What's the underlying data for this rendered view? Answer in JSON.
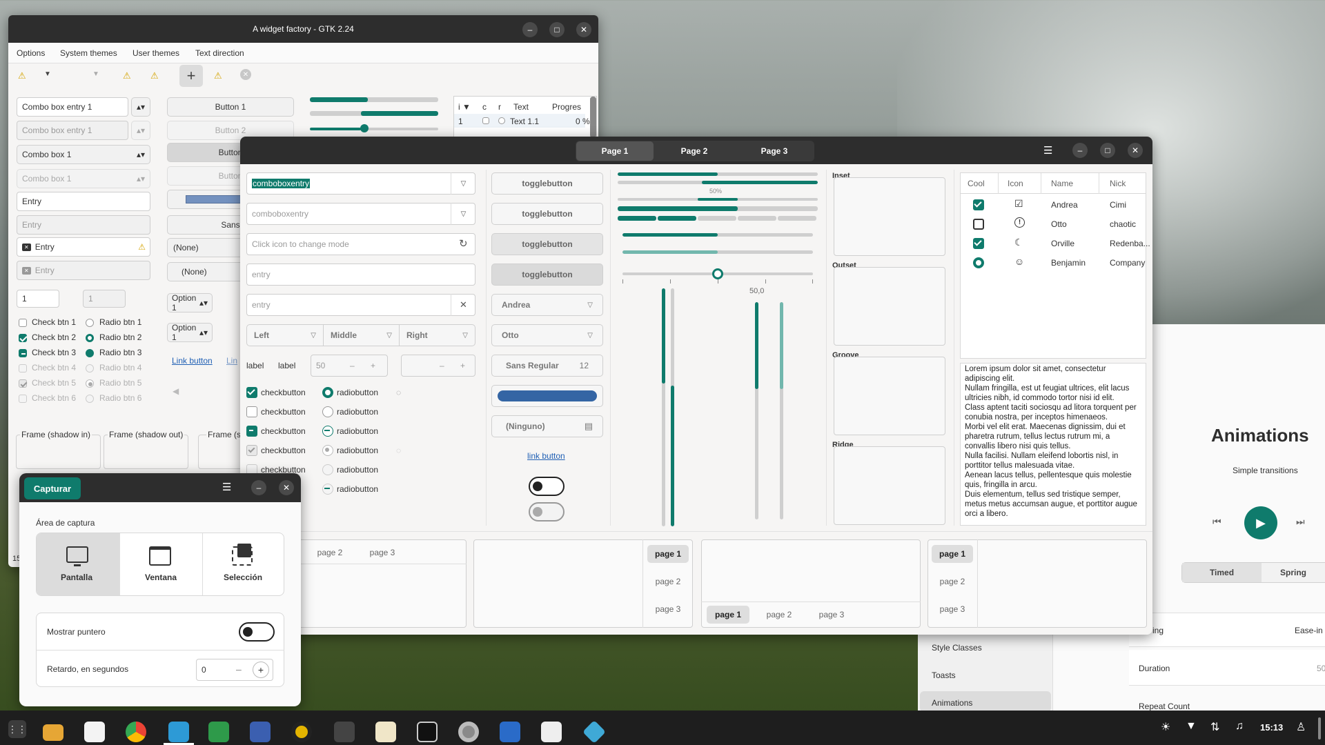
{
  "colors": {
    "accent": "#0f7b6c",
    "blue": "#3465a4",
    "dark": "#2d2d2d"
  },
  "gtk2": {
    "title": "A widget factory - GTK 2.24",
    "menu": [
      "Options",
      "System themes",
      "User themes",
      "Text direction"
    ],
    "combo_entry_1": "Combo box entry 1",
    "combo_entry_1_dis": "Combo box entry 1",
    "combo_box_1": "Combo box 1",
    "combo_box_1_dis": "Combo box 1",
    "entry": "Entry",
    "entry_dis": "Entry",
    "entry_icon": "Entry",
    "entry_icon_dis": "Entry",
    "spin1": "1",
    "spin2": "1",
    "checks": [
      "Check btn 1",
      "Check btn 2",
      "Check btn 3",
      "Check btn 4",
      "Check btn 5",
      "Check btn 6"
    ],
    "radios": [
      "Radio btn 1",
      "Radio btn 2",
      "Radio btn 3",
      "Radio btn 4",
      "Radio btn 5",
      "Radio btn 6"
    ],
    "buttons": [
      "Button 1",
      "Button 2",
      "Button",
      "Button"
    ],
    "font_btn": "Sans",
    "none1": "(None)",
    "none2": "(None)",
    "option1": "Option 1",
    "option2": "Option 1",
    "link1": "Link button",
    "link2": "Lin",
    "frames": [
      "Frame (shadow in)",
      "Frame (shadow out)",
      "Frame (s"
    ],
    "tree_headers": [
      "i",
      "c",
      "r",
      "Text",
      "Progres"
    ],
    "tree_row": {
      "i": "1",
      "text": "Text 1.1",
      "progress": "0 %"
    },
    "status": "15"
  },
  "gtk4": {
    "tabs": [
      "Page 1",
      "Page 2",
      "Page 3"
    ],
    "combo_entry": "comboboxentry",
    "combo_entry_ph": "comboboxentry",
    "mode_ph": "Click icon to change mode",
    "entry_ph1": "entry",
    "entry_ph2": "entry",
    "linked": [
      "Left",
      "Middle",
      "Right"
    ],
    "label1": "label",
    "label2": "label",
    "spin": "50",
    "checkbox": "checkbutton",
    "radio": "radiobutton",
    "toggles": [
      "togglebutton",
      "togglebutton",
      "togglebutton",
      "togglebutton"
    ],
    "combo_andrea": "Andrea",
    "combo_otto": "Otto",
    "font": "Sans Regular",
    "font_size": "12",
    "file": "(Ninguno)",
    "link": "link button",
    "pct": "50%",
    "scale_val": "50,0",
    "frames": [
      "Inset",
      "Outset",
      "Groove",
      "Ridge"
    ],
    "list_headers": [
      "Cool",
      "Icon",
      "Name",
      "Nick"
    ],
    "list": [
      {
        "name": "Andrea",
        "nick": "Cimi",
        "icon": "check-circle-icon"
      },
      {
        "name": "Otto",
        "nick": "chaotic",
        "icon": "alert-icon"
      },
      {
        "name": "Orville",
        "nick": "Redenba...",
        "icon": "weather-icon"
      },
      {
        "name": "Benjamin",
        "nick": "Company",
        "icon": "face-icon"
      }
    ],
    "lorem": "Lorem ipsum dolor sit amet, consectetur adipiscing elit.\nNullam fringilla, est ut feugiat ultrices, elit lacus ultricies nibh, id commodo tortor nisi id elit.\nClass aptent taciti sociosqu ad litora torquent per conubia nostra, per inceptos himenaeos.\nMorbi vel elit erat. Maecenas dignissim, dui et pharetra rutrum, tellus lectus rutrum mi, a convallis libero nisi quis tellus.\nNulla facilisi. Nullam eleifend lobortis nisl, in porttitor tellus malesuada vitae.\nAenean lacus tellus, pellentesque quis molestie quis, fringilla in arcu.\nDuis elementum, tellus sed tristique semper, metus metus accumsan augue, et porttitor augue orci a libero.",
    "nb_tabs": [
      "page 1",
      "page 2",
      "page 3"
    ]
  },
  "capture": {
    "title": "Capturar",
    "area_label": "Área de captura",
    "modes": [
      "Pantalla",
      "Ventana",
      "Selección"
    ],
    "show_pointer": "Mostrar puntero",
    "delay": "Retardo, en segundos",
    "delay_val": "0"
  },
  "demo": {
    "title": "Animations",
    "subtitle": "Simple transitions",
    "tabs": [
      "Timed",
      "Spring"
    ],
    "sidebar": [
      "Style Classes",
      "Toasts",
      "Animations"
    ],
    "rows": [
      {
        "label": "ing",
        "value": "Ease-in"
      },
      {
        "label": "Duration",
        "value": "50"
      },
      {
        "label": "Repeat Count",
        "value": ""
      }
    ]
  },
  "taskbar": {
    "time": "15:13"
  }
}
